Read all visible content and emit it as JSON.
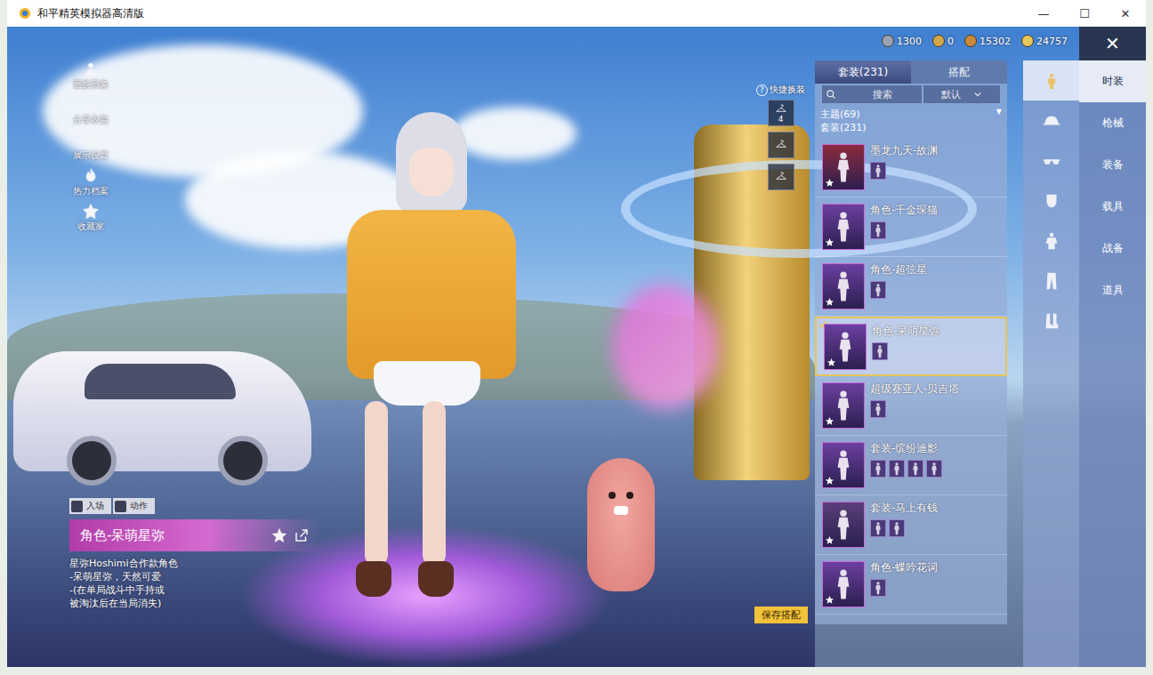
{
  "window": {
    "title": "和平精英模拟器高清版",
    "controls": [
      "—",
      "☐",
      "✕"
    ]
  },
  "currencies": [
    {
      "value": "1300",
      "color": "#9aa3b5"
    },
    {
      "value": "0",
      "color": "#d4a84a"
    },
    {
      "value": "15302",
      "color": "#c98a3a"
    },
    {
      "value": "24757",
      "color": "#e7c65a"
    }
  ],
  "close": "✕",
  "side_menu": [
    {
      "label": "更换形象"
    },
    {
      "label": "分享衣装"
    },
    {
      "label": "展示设置"
    },
    {
      "label": "热力档案"
    },
    {
      "label": "收藏家"
    }
  ],
  "quick_change": {
    "label": "快捷换装",
    "help": "?",
    "slots": [
      {
        "badge": "4"
      },
      {},
      {}
    ]
  },
  "list_tabs": [
    {
      "label": "套装(231)",
      "selected": true
    },
    {
      "label": "搭配",
      "selected": false
    }
  ],
  "search": {
    "placeholder": "搜索"
  },
  "sort": {
    "value": "默认"
  },
  "filters": {
    "theme": "主题(69)",
    "theme_arrow": "▼",
    "set": "套装(231)"
  },
  "items": [
    {
      "name": "墨龙九天-故渊",
      "selected": false,
      "color": "#8c2a3e",
      "pieces": 1
    },
    {
      "name": "角色-千金琛猫",
      "selected": false,
      "color": "#6b3fa0",
      "pieces": 1
    },
    {
      "name": "角色-超弦星",
      "selected": false,
      "color": "#6b3fa0",
      "pieces": 1
    },
    {
      "name": "角色-呆萌星弥",
      "selected": true,
      "color": "#6b3fa0",
      "pieces": 1
    },
    {
      "name": "超级赛亚人-贝吉塔",
      "selected": false,
      "color": "#6b3fa0",
      "pieces": 1
    },
    {
      "name": "套装-缤纷迪影",
      "selected": false,
      "color": "#6b3fa0",
      "pieces": 4
    },
    {
      "name": "套装-马上有钱",
      "selected": false,
      "color": "#5a3f7a",
      "pieces": 2
    },
    {
      "name": "角色-蝶吟花词",
      "selected": false,
      "color": "#6b3fa0",
      "pieces": 1
    }
  ],
  "categories": [
    {
      "selected": true
    },
    {
      "selected": false
    },
    {
      "selected": false
    },
    {
      "selected": false
    },
    {
      "selected": false
    },
    {
      "selected": false
    },
    {
      "selected": false
    }
  ],
  "menu_tabs": [
    {
      "label": "时装",
      "selected": true
    },
    {
      "label": "枪械",
      "selected": false
    },
    {
      "label": "装备",
      "selected": false
    },
    {
      "label": "载具",
      "selected": false
    },
    {
      "label": "战备",
      "selected": false
    },
    {
      "label": "道具",
      "selected": false
    }
  ],
  "emote_buttons": [
    {
      "label": "入场"
    },
    {
      "label": "动作"
    }
  ],
  "outfit": {
    "name": "角色-呆萌星弥",
    "description": [
      "星弥Hoshimi合作款角色",
      "-呆萌星弥，天然可爱",
      "-(在单局战斗中手持或",
      "被淘汰后在当局消失)"
    ]
  },
  "save_button": "保存搭配"
}
